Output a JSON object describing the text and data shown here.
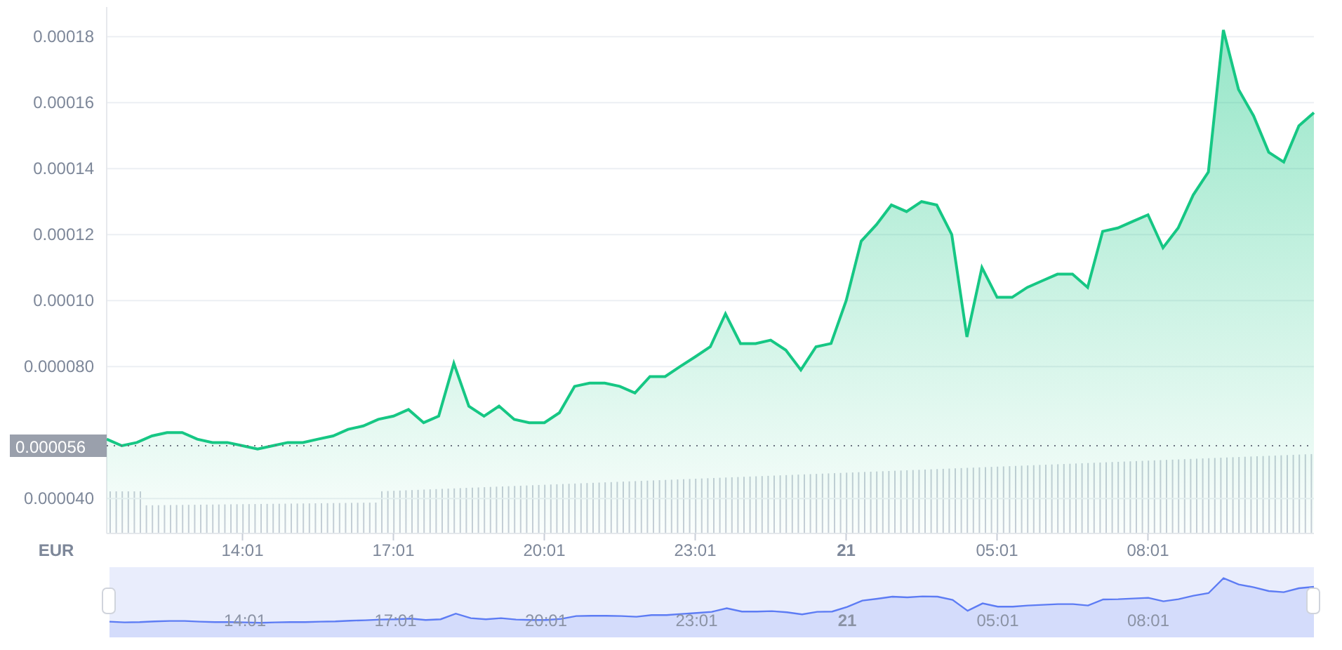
{
  "chart": {
    "currency": "EUR",
    "chart_data": {
      "type": "area",
      "grid": true,
      "ylim": [
        2.94e-05,
        0.000189
      ],
      "categories": [
        null,
        null,
        null,
        null,
        null,
        null,
        null,
        null,
        null,
        "14:01",
        null,
        null,
        null,
        null,
        null,
        null,
        null,
        null,
        null,
        "17:01",
        null,
        null,
        null,
        null,
        null,
        null,
        null,
        null,
        null,
        "20:01",
        null,
        null,
        null,
        null,
        null,
        null,
        null,
        null,
        null,
        "23:01",
        null,
        null,
        null,
        null,
        null,
        null,
        null,
        null,
        null,
        "21",
        null,
        null,
        null,
        null,
        null,
        null,
        null,
        null,
        null,
        "05:01",
        null,
        null,
        null,
        null,
        null,
        null,
        null,
        null,
        null,
        "08:01",
        null,
        null,
        null,
        null,
        null,
        null,
        null,
        null,
        null,
        null,
        null
      ],
      "yticks": [
        {
          "value": 4e-05,
          "label": "0.000040"
        },
        {
          "value": 8e-05,
          "label": "0.000080"
        },
        {
          "value": 0.0001,
          "label": "0.00010"
        },
        {
          "value": 0.00012,
          "label": "0.00012"
        },
        {
          "value": 0.00014,
          "label": "0.00014"
        },
        {
          "value": 0.00016,
          "label": "0.00016"
        },
        {
          "value": 0.00018,
          "label": "0.00018"
        }
      ],
      "series": [
        {
          "color": "#16c784",
          "values": [
            5.8e-05,
            5.6e-05,
            5.7e-05,
            5.9e-05,
            6e-05,
            6e-05,
            5.8e-05,
            5.7e-05,
            5.7e-05,
            5.6e-05,
            5.5e-05,
            5.6e-05,
            5.7e-05,
            5.7e-05,
            5.8e-05,
            5.9e-05,
            6.1e-05,
            6.2e-05,
            6.4e-05,
            6.5e-05,
            6.7e-05,
            6.3e-05,
            6.5e-05,
            8.1e-05,
            6.8e-05,
            6.5e-05,
            6.8e-05,
            6.4e-05,
            6.3e-05,
            6.3e-05,
            6.6e-05,
            7.4e-05,
            7.5e-05,
            7.5e-05,
            7.4e-05,
            7.2e-05,
            7.7e-05,
            7.7e-05,
            8e-05,
            8.3e-05,
            8.6e-05,
            9.6e-05,
            8.7e-05,
            8.7e-05,
            8.8e-05,
            8.5e-05,
            7.9e-05,
            8.6e-05,
            8.7e-05,
            0.0001,
            0.000118,
            0.000123,
            0.000129,
            0.000127,
            0.00013,
            0.000129,
            0.00012,
            8.9e-05,
            0.00011,
            0.000101,
            0.000101,
            0.000104,
            0.000106,
            0.000108,
            0.000108,
            0.000104,
            0.000121,
            0.000122,
            0.000124,
            0.000126,
            0.000116,
            0.000122,
            0.000132,
            0.000139,
            0.000182,
            0.000164,
            0.000156,
            0.000145,
            0.000142,
            0.000153,
            0.000157
          ]
        }
      ],
      "ref_lines": [
        {
          "axis": "y",
          "value": 5.6e-05,
          "label": "0.000056"
        }
      ]
    }
  },
  "navigator": {
    "labels": [
      {
        "text": "14:01",
        "bold": false
      },
      {
        "text": "17:01",
        "bold": false
      },
      {
        "text": "20:01",
        "bold": false
      },
      {
        "text": "23:01",
        "bold": false
      },
      {
        "text": "21",
        "bold": true
      },
      {
        "text": "05:01",
        "bold": false
      },
      {
        "text": "08:01",
        "bold": false
      }
    ]
  }
}
